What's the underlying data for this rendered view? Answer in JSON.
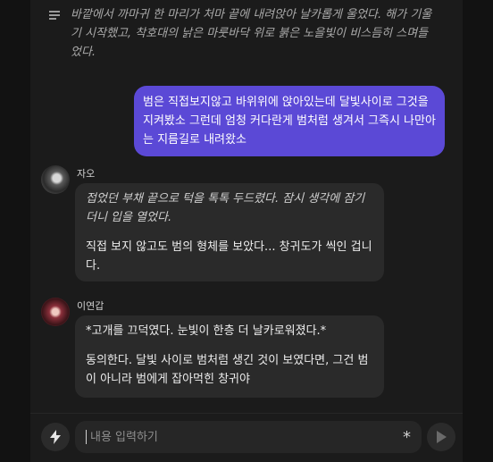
{
  "narration": {
    "text": "바깥에서 까마귀 한 마리가 처마 끝에 내려앉아 날카롭게 울었다. 해가 기울기 시작했고, 착호대의 낡은 마룻바닥 위로 붉은 노을빛이 비스듬히 스며들었다."
  },
  "user_message": {
    "text": "범은 직접보지않고 바위위에 앉아있는데 달빛사이로 그것을 지켜봤소 그런데 엄청 커다란게 범처럼 생겨서 그즉시 나만아는 지름길로 내려왔소"
  },
  "messages": [
    {
      "name": "자오",
      "action": "접었던 부채 끝으로 턱을 톡톡 두드렸다. 잠시 생각에 잠기더니 입을 열었다.",
      "speech": "직접 보지 않고도 범의 형체를 보았다... 창귀도가 씩인 겁니다."
    },
    {
      "name": "이연갑",
      "action": "*고개를 끄덕였다. 눈빛이 한층 더 날카로워졌다.*",
      "speech": "동의한다. 달빛 사이로 범처럼 생긴 것이 보였다면, 그건 범이 아니라 범에게 잡아먹힌 창귀야"
    }
  ],
  "input": {
    "placeholder": "내용 입력하기",
    "asterisk": "*"
  },
  "icons": {
    "menu": "menu-lines-icon",
    "bolt": "lightning-bolt-icon",
    "send": "play-send-icon"
  },
  "colors": {
    "user_bubble": "#5b49d6",
    "char_bubble": "#2a2a2a",
    "background": "#1b1b1b"
  }
}
